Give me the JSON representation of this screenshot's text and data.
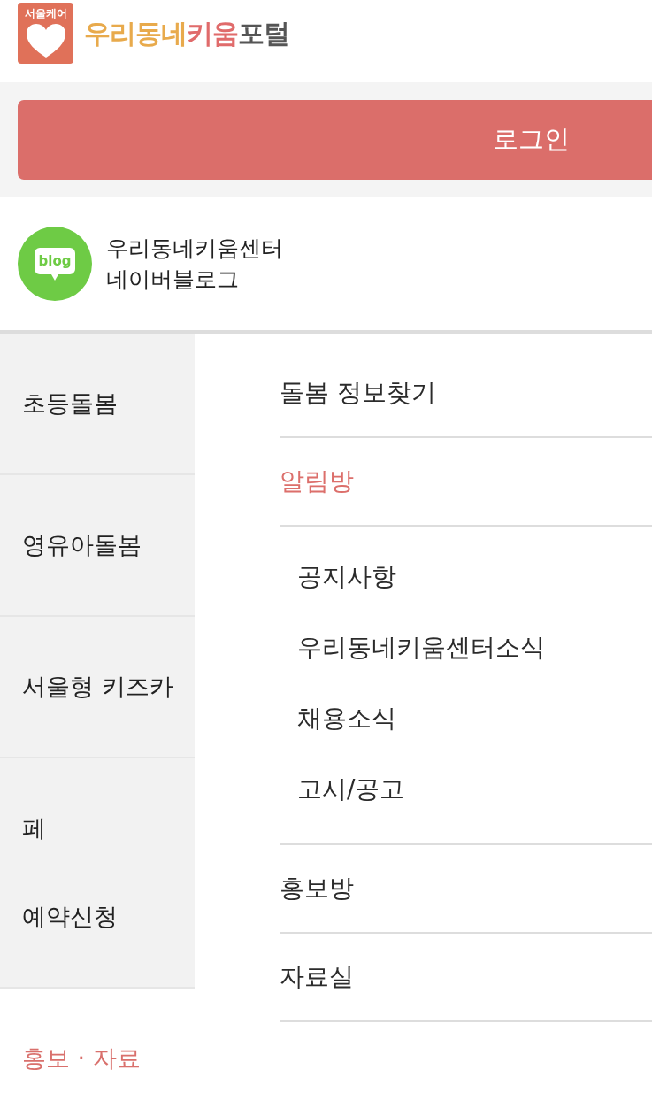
{
  "header": {
    "logo": {
      "caption": "서울케어",
      "title_parts": [
        {
          "text": "우리동네",
          "color": "#e8aa4c"
        },
        {
          "text": "키움",
          "color": "#e06b6b"
        },
        {
          "text": "포털",
          "color": "#555555"
        }
      ]
    }
  },
  "login_button": {
    "label": "로그인"
  },
  "blog_link": {
    "badge_text": "blog",
    "lines": [
      "우리동네키움센터",
      "네이버블로그"
    ]
  },
  "side_menu": {
    "items": [
      {
        "lines": [
          "초등돌봄"
        ],
        "selected": false
      },
      {
        "lines": [
          "영유아돌봄"
        ],
        "selected": false
      },
      {
        "lines": [
          "서울형 키즈카"
        ],
        "selected": false
      },
      {
        "lines": [
          "페",
          "예약신청"
        ],
        "selected": false
      },
      {
        "lines": [
          "홍보 · 자료"
        ],
        "selected": true
      }
    ]
  },
  "sub_menu": {
    "items": [
      {
        "label": "돌봄 정보찾기",
        "selected": false
      },
      {
        "label": "알림방",
        "selected": true,
        "children": [
          {
            "label": "공지사항"
          },
          {
            "label": "우리동네키움센터소식"
          },
          {
            "label": "채용소식"
          },
          {
            "label": "고시/공고"
          }
        ]
      },
      {
        "label": "홍보방",
        "selected": false
      },
      {
        "label": "자료실",
        "selected": false
      }
    ]
  }
}
